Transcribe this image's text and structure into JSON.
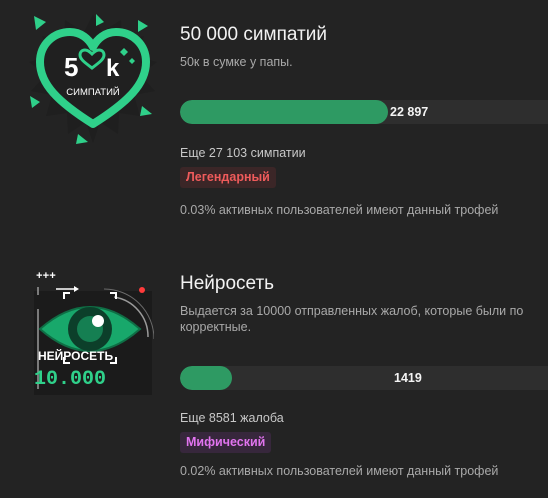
{
  "trophies": [
    {
      "title": "50 000 симпатий",
      "description": "50к в сумке у папы.",
      "progress_fraction": 0.565,
      "progress_text": "22 897",
      "remaining": "Еще 27 103 симпатии",
      "rarity": "Легендарный",
      "percent_text": "0.03% активных пользователей имеют данный трофей",
      "badge": {
        "big_text_left": "5",
        "big_text_right": "k",
        "small_text": "СИМПАТИЙ",
        "icon": "heart-badge-icon"
      }
    },
    {
      "title": "Нейросеть",
      "description": "Выдается за 10000 отправленных жалоб, которые были по\nкорректные.",
      "progress_fraction": 0.142,
      "progress_text": "1419",
      "remaining": "Еще 8581 жалоба",
      "rarity": "Мифический",
      "percent_text": "0.02% активных пользователей имеют данный трофей",
      "badge": {
        "word_text": "НЕЙРОСЕТЬ",
        "number_text": "10.000",
        "top_marks": "+++",
        "icon": "eye-badge-icon"
      }
    }
  ],
  "colors": {
    "background": "#232323",
    "accent_green": "#2e9a63",
    "legendary_text": "#ef5b5b",
    "mythic_text": "#e174ef"
  }
}
